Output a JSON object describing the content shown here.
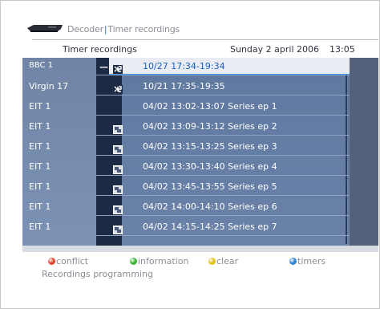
{
  "breadcrumb": {
    "section": "Decoder",
    "page": "Timer recordings"
  },
  "header": {
    "title": "Timer recordings",
    "date": "Sunday 2 april 2006",
    "time": "13:05"
  },
  "rows": [
    {
      "channel": "BBC 1",
      "icon": "conflict-icon",
      "text": "10/27  17:34-19:34",
      "selected": true
    },
    {
      "channel": "Virgin 17",
      "icon": "conflict-icon",
      "text": "10/21  17:35-19:35",
      "selected": false
    },
    {
      "channel": "EIT 1",
      "icon": "",
      "text": "04/02  13:02-13:07  Series ep 1",
      "selected": false
    },
    {
      "channel": "EIT 1",
      "icon": "series-icon",
      "text": "04/02  13:09-13:12  Series ep 2",
      "selected": false
    },
    {
      "channel": "EIT 1",
      "icon": "series-icon",
      "text": "04/02  13:15-13:25  Series ep 3",
      "selected": false
    },
    {
      "channel": "EIT 1",
      "icon": "series-icon",
      "text": "04/02  13:30-13:40  Series ep 4",
      "selected": false
    },
    {
      "channel": "EIT 1",
      "icon": "series-icon",
      "text": "04/02  13:45-13:55  Series ep 5",
      "selected": false
    },
    {
      "channel": "EIT 1",
      "icon": "series-icon",
      "text": "04/02  14:00-14:10  Series ep 6",
      "selected": false
    },
    {
      "channel": "EIT 1",
      "icon": "series-icon",
      "text": "04/02  14:15-14:25  Series ep 7",
      "selected": false
    }
  ],
  "legend": {
    "conflict": {
      "label": "conflict",
      "color": "#e0472e"
    },
    "information": {
      "label": "information",
      "color": "#3fb33a"
    },
    "clear": {
      "label": "clear",
      "color": "#e3c21b"
    },
    "timers": {
      "label": "timers",
      "color": "#2f86d9"
    }
  },
  "footer": {
    "label": "Recordings programming"
  }
}
